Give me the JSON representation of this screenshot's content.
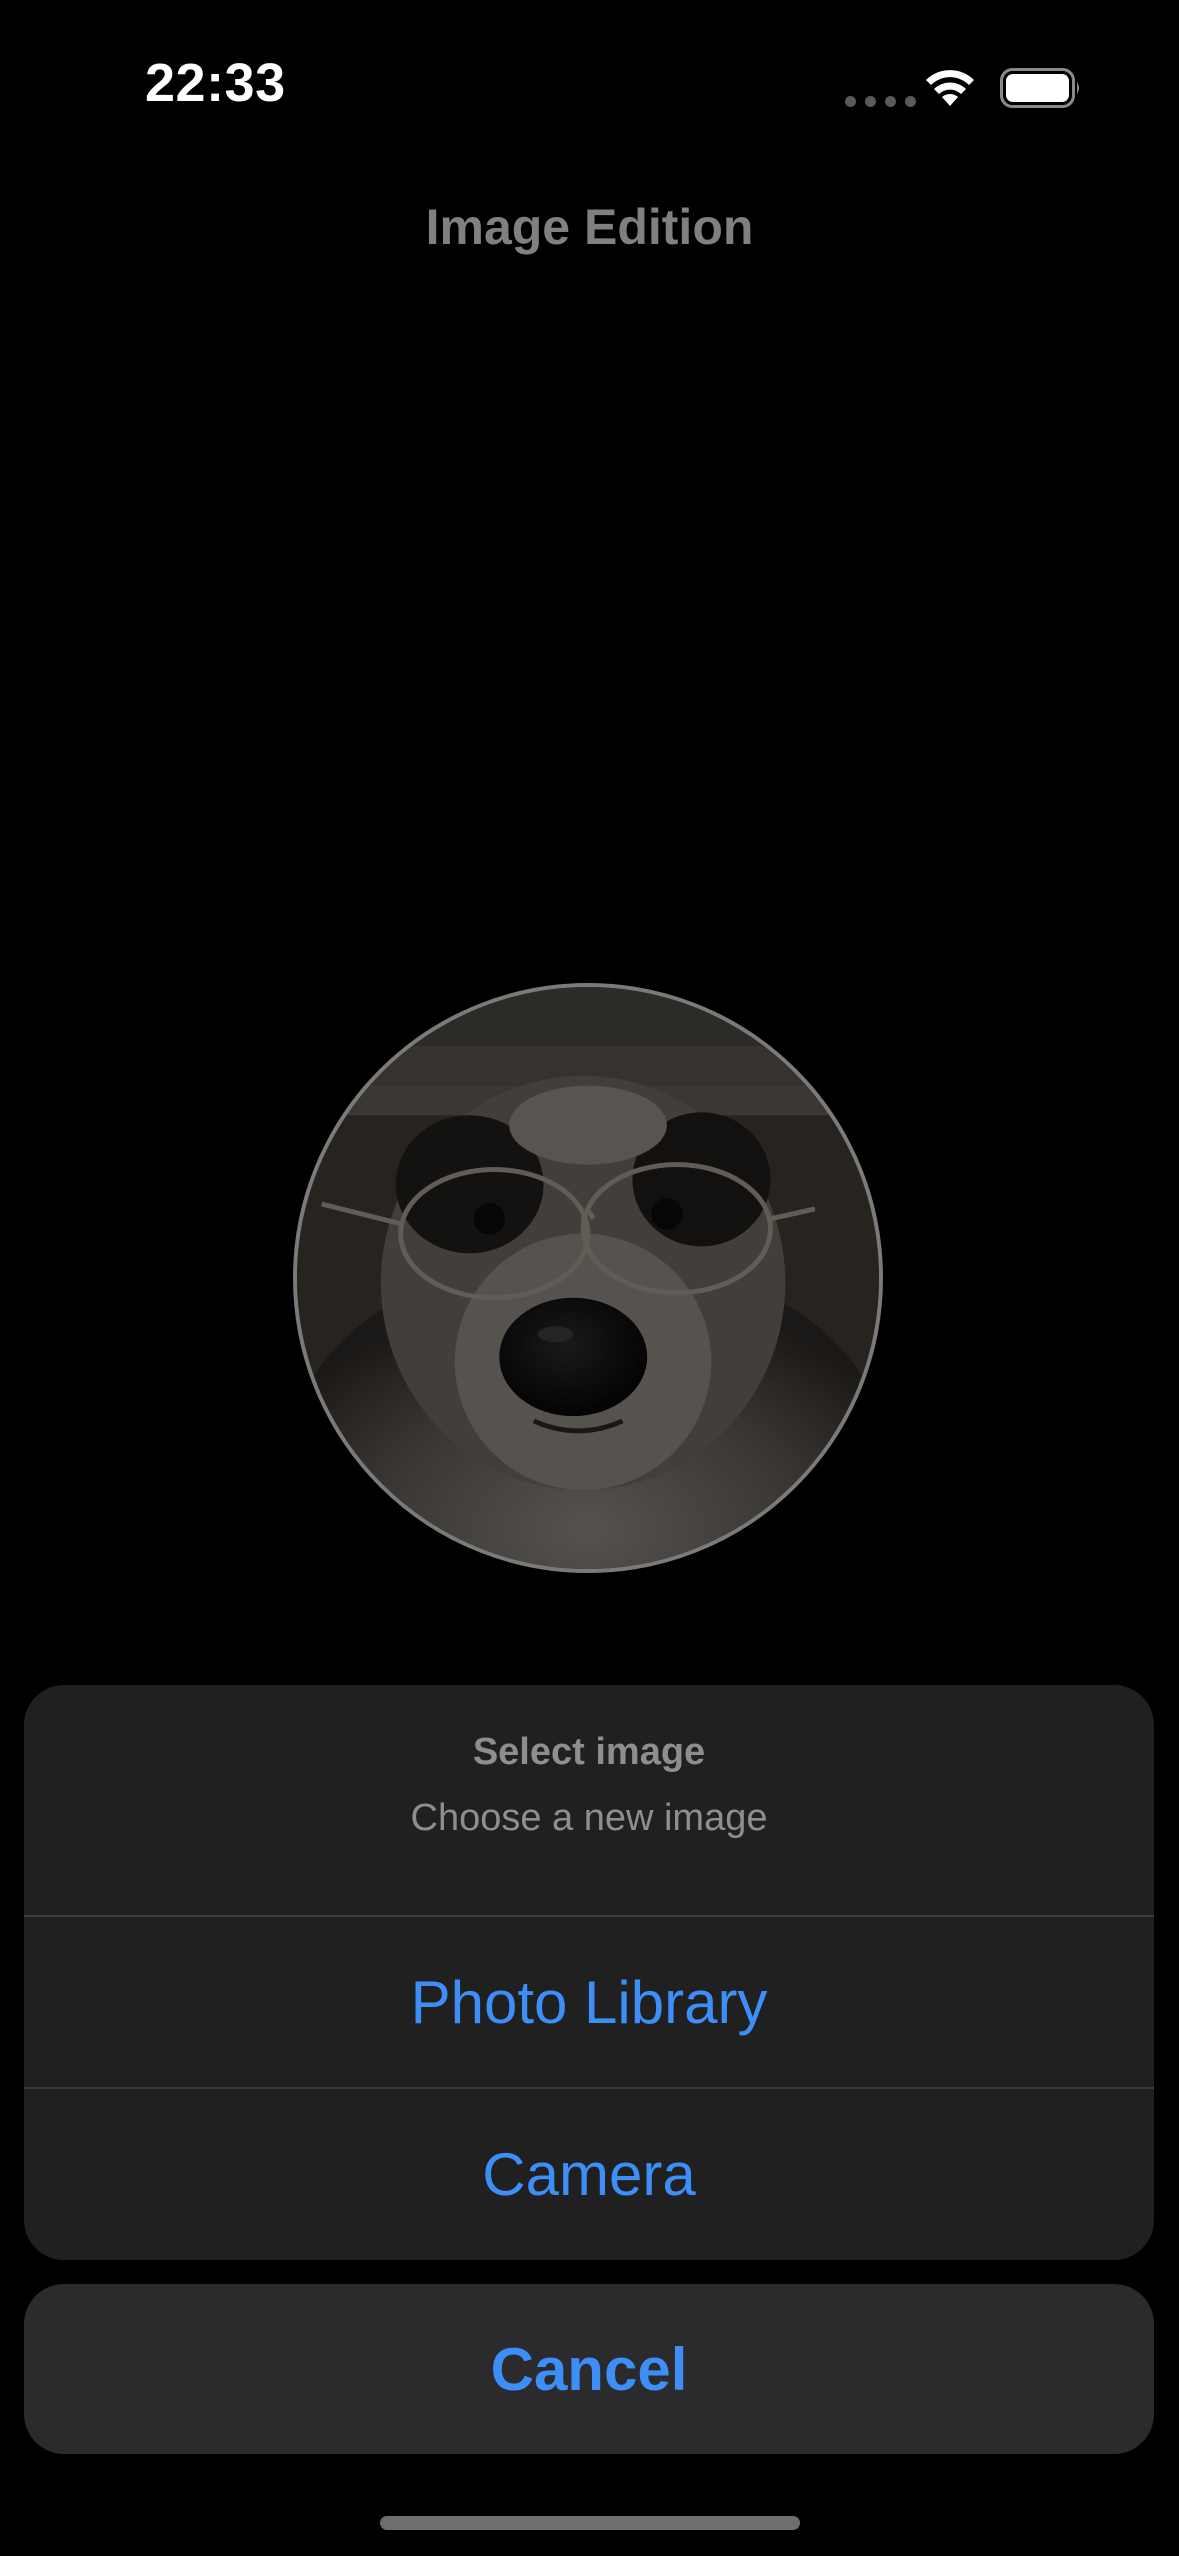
{
  "status_bar": {
    "time": "22:33",
    "icons": [
      "cellular-signal-icon",
      "wifi-icon",
      "battery-icon"
    ]
  },
  "header": {
    "title": "Image Edition"
  },
  "avatar": {
    "description_icon": "profile-photo"
  },
  "action_sheet": {
    "title": "Select image",
    "message": "Choose a new image",
    "actions": [
      {
        "label": "Photo Library"
      },
      {
        "label": "Camera"
      }
    ],
    "cancel_label": "Cancel"
  },
  "colors": {
    "background": "#000000",
    "sheet_background": "#202020",
    "action_tint": "#3d8ef7",
    "muted_text": "#8e8e8e"
  }
}
